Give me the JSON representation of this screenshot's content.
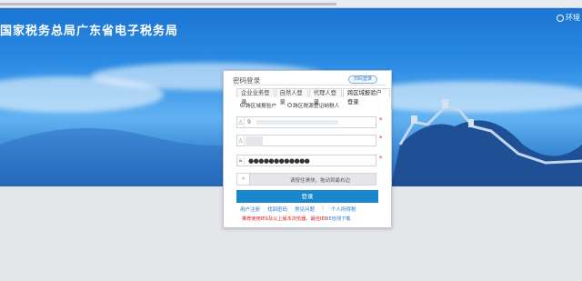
{
  "header": {
    "title": "国家税务总局广东省电子税务局",
    "right_text": "环境"
  },
  "login": {
    "title": "密码登录",
    "switch_label": "扫码登录",
    "tabs": [
      {
        "label": "企业业务登录",
        "active": false
      },
      {
        "label": "自然人登录",
        "active": false
      },
      {
        "label": "代理人登录",
        "active": false
      },
      {
        "label": "跨区域报验户登录",
        "active": true
      }
    ],
    "radios": [
      {
        "label": "跨区域报验户",
        "selected": true
      },
      {
        "label": "跨区税源登记纳税人",
        "selected": false
      }
    ],
    "account_prefix": "9",
    "password_mask": "●●●●●●●●●●●●",
    "required_mark": "*",
    "slider_text": "请按住滑块，拖动到最右边",
    "slider_handle": "»",
    "submit_label": "登录",
    "links": [
      "用户注册",
      "找回密码",
      "常见问题",
      "个人所得税"
    ],
    "link_separator": "|",
    "notice_text": "推荐使用IE9及以上版本浏览器，最佳IE8",
    "notice_link": "IE检测下载"
  },
  "colors": {
    "primary": "#1a86cc",
    "link": "#2a7bd3",
    "required": "#d42020"
  }
}
